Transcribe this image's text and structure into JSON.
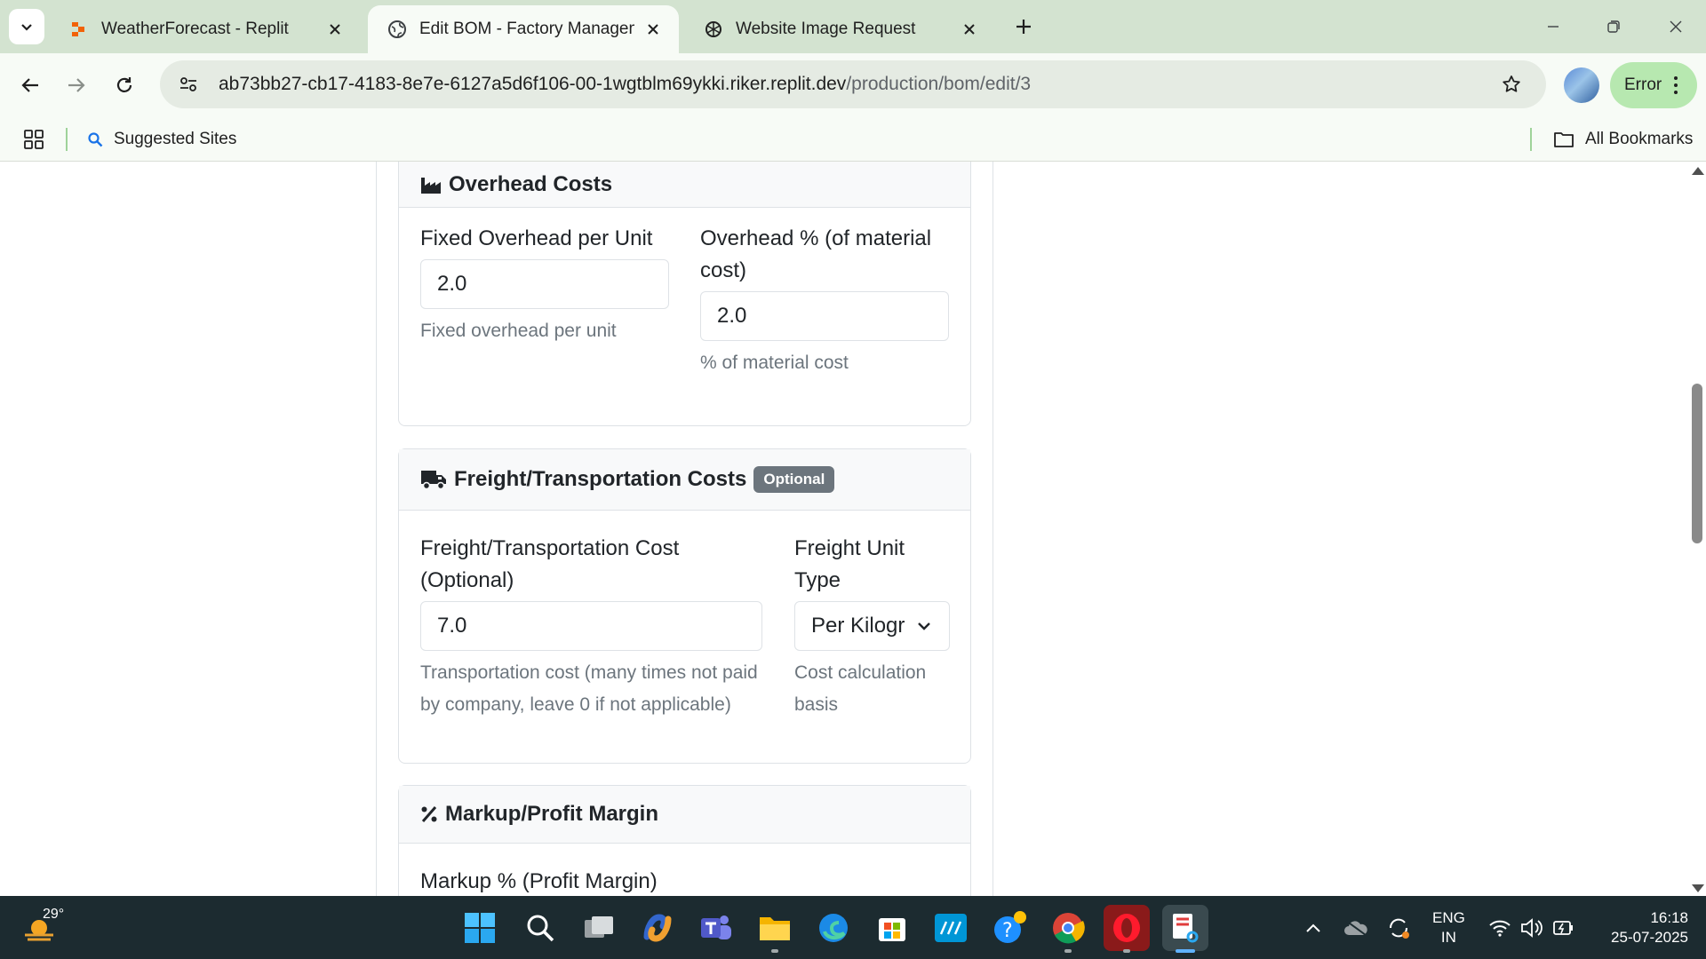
{
  "browser": {
    "tabs": [
      {
        "title": "WeatherForecast - Replit",
        "active": false
      },
      {
        "title": "Edit BOM - Factory Management",
        "active": true
      },
      {
        "title": "Website Image Request",
        "active": false
      }
    ],
    "url_host": "ab73bb27-cb17-4183-8e7e-6127a5d6f106-00-1wgtblm69ykki.riker.replit.dev",
    "url_path": "/production/bom/edit/3",
    "profile_status": "Error",
    "bookmarks": {
      "suggested": "Suggested Sites",
      "all": "All Bookmarks"
    }
  },
  "overhead": {
    "title": "Overhead Costs",
    "fixed_label": "Fixed Overhead per Unit",
    "fixed_value": "2.0",
    "fixed_help": "Fixed overhead per unit",
    "pct_label_1": "Overhead % (of material",
    "pct_label_2": "cost)",
    "pct_value": "2.0",
    "pct_help": "% of material cost"
  },
  "freight": {
    "title": "Freight/Transportation Costs",
    "badge": "Optional",
    "cost_label_1": "Freight/Transportation Cost",
    "cost_label_2": "(Optional)",
    "cost_value": "7.0",
    "cost_help_1": "Transportation cost (many times not paid",
    "cost_help_2": "by company, leave 0 if not applicable)",
    "unit_label_1": "Freight Unit",
    "unit_label_2": "Type",
    "unit_value": "Per Kilogr",
    "unit_help_1": "Cost calculation",
    "unit_help_2": "basis"
  },
  "markup": {
    "title": "Markup/Profit Margin",
    "pct_label": "Markup % (Profit Margin)"
  },
  "taskbar": {
    "temperature": "29°",
    "lang_1": "ENG",
    "lang_2": "IN",
    "time": "16:18",
    "date": "25-07-2025"
  }
}
